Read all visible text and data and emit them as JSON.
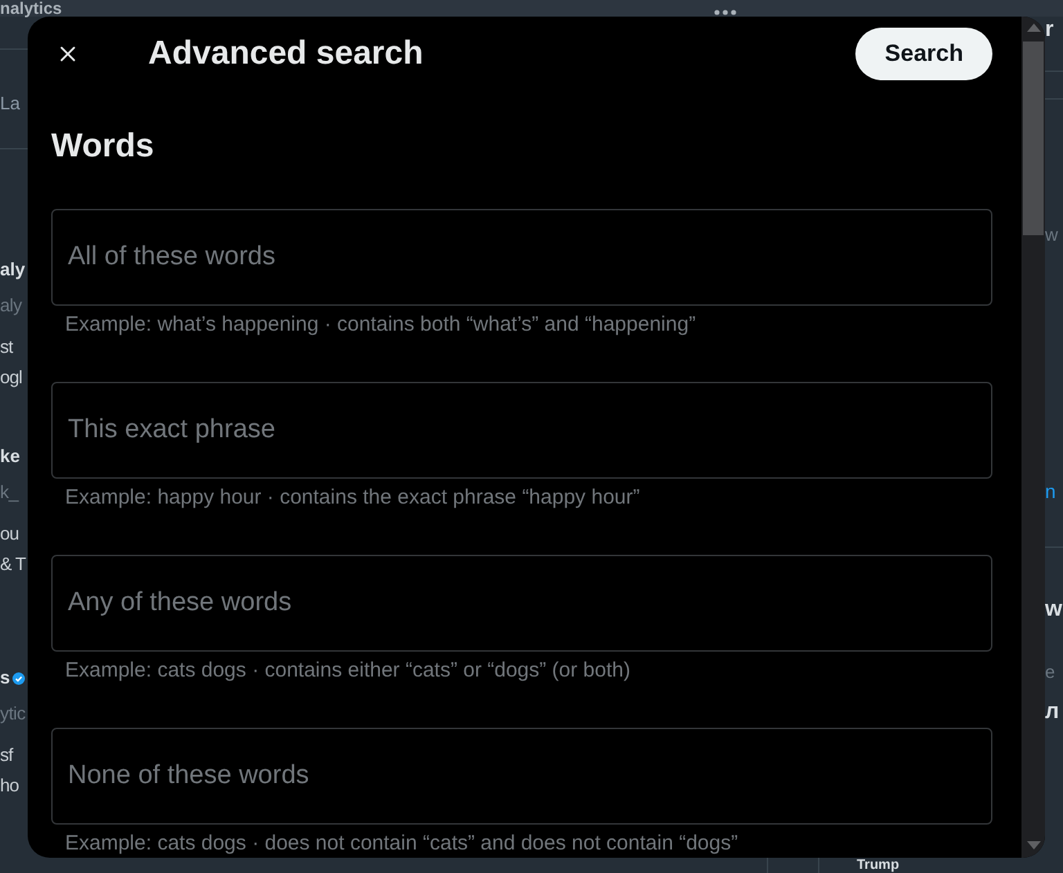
{
  "background": {
    "header_title": "nalytics",
    "left_column": {
      "tab": "La",
      "posts": [
        {
          "name": "aly",
          "handle": "aly",
          "verified": false,
          "lines": [
            "st",
            "ogl"
          ]
        },
        {
          "name": "ke",
          "handle": "k_",
          "verified": false,
          "lines": [
            "ou",
            "& T"
          ]
        },
        {
          "name": "s",
          "handle": "ytic",
          "verified": true,
          "lines": [
            "sf",
            "ho"
          ]
        }
      ]
    },
    "right_column": {
      "heading": "r",
      "sections": [
        {
          "items": [
            {
              "kind": "meta",
              "text": "w"
            },
            {
              "kind": "link",
              "text": "n"
            }
          ]
        },
        {
          "items": [
            {
              "kind": "title",
              "text": "w"
            },
            {
              "kind": "meta",
              "text": "e"
            },
            {
              "kind": "title",
              "text": "л"
            }
          ]
        }
      ]
    },
    "bottom_trend": "Trump"
  },
  "dialog": {
    "title": "Advanced search",
    "search_button": "Search",
    "section_title": "Words",
    "fields": [
      {
        "placeholder": "All of these words",
        "hint": "Example: what’s happening · contains both “what’s” and “happening”"
      },
      {
        "placeholder": "This exact phrase",
        "hint": "Example: happy hour · contains the exact phrase “happy hour”"
      },
      {
        "placeholder": "Any of these words",
        "hint": "Example: cats dogs · contains either “cats” or “dogs” (or both)"
      },
      {
        "placeholder": "None of these words",
        "hint": "Example: cats dogs · does not contain “cats” and does not contain “dogs”"
      }
    ]
  }
}
